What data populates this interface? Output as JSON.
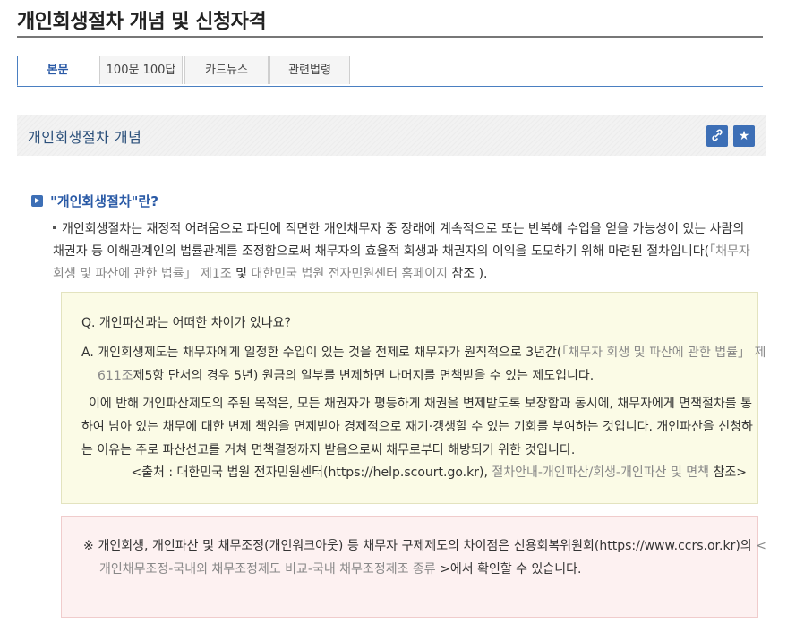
{
  "page": {
    "title": "개인회생절차 개념 및 신청자격"
  },
  "tabs": [
    {
      "label": "본문",
      "active": true
    },
    {
      "label": "100문 100답",
      "active": false
    },
    {
      "label": "카드뉴스",
      "active": false
    },
    {
      "label": "관련법령",
      "active": false
    }
  ],
  "section": {
    "title": "개인회생절차 개념",
    "link_icon": "link-icon",
    "star_icon": "star-icon"
  },
  "subhead": {
    "label": "\"개인회생절차\"란?"
  },
  "paragraph": {
    "text_before": "개인회생절차는 재정적 어려움으로 파탄에 직면한 개인채무자 중 장래에 계속적으로 또는 반복해 수입을 얻을 가능성이 있는 사람의 채권자 등 이해관계인의 법률관계를 조정함으로써 채무자의 효율적 회생과 채권자의 이익을 도모하기 위해 마련된 절차입니다(",
    "law_link": "「채무자 회생 및 파산에 관한 법률」 제1조",
    "and": " 및 ",
    "site_link": "대한민국 법원 전자민원센터 홈페이지",
    "text_after": " 참조 )."
  },
  "qa": {
    "question": "Q. 개인파산과는 어떠한 차이가 있나요?",
    "answer_before": "A. 개인회생제도는 채무자에게 일정한 수입이 있는 것을 전제로 채무자가 원칙적으로 3년간(",
    "answer_link": "「채무자 회생 및 파산에 관한 법률」 제611조",
    "answer_after": "제5항 단서의 경우 5년) 원금의 일부를 변제하면 나머지를 면책받을 수 있는 제도입니다.",
    "answer2": "이에 반해 개인파산제도의 주된 목적은, 모든 채권자가 평등하게 채권을 변제받도록 보장함과 동시에, 채무자에게 면책절차를 통하여 남아 있는 채무에 대한 변제 책임을 면제받아 경제적으로 재기·갱생할 수 있는 기회를 부여하는 것입니다. 개인파산을 신청하는 이유는 주로 파산선고를 거쳐 면책결정까지 받음으로써 채무로부터 해방되기 위한 것입니다.",
    "source_before": "<출처 : 대한민국 법원 전자민원센터(https://help.scourt.go.kr), ",
    "source_link": "절차안내-개인파산/회생-개인파산 및 면책",
    "source_after": " 참조>"
  },
  "note": {
    "text_before": "※ 개인회생, 개인파산 및 채무조정(개인워크아웃) 등 채무자 구제제도의 차이점은 신용회복위원회(https://www.ccrs.or.kr)의 ",
    "link": "< 개인채무조정-국내외 채무조정제도 비교-국내 채무조정제조 종류",
    "text_after": " >에서 확인할 수 있습니다."
  },
  "colors": {
    "accent": "#3d6fb6",
    "tab_active": "#2a5aa6",
    "qa_bg": "#fbfbe6",
    "note_bg": "#fdf1f1",
    "link_gray": "#888888"
  }
}
